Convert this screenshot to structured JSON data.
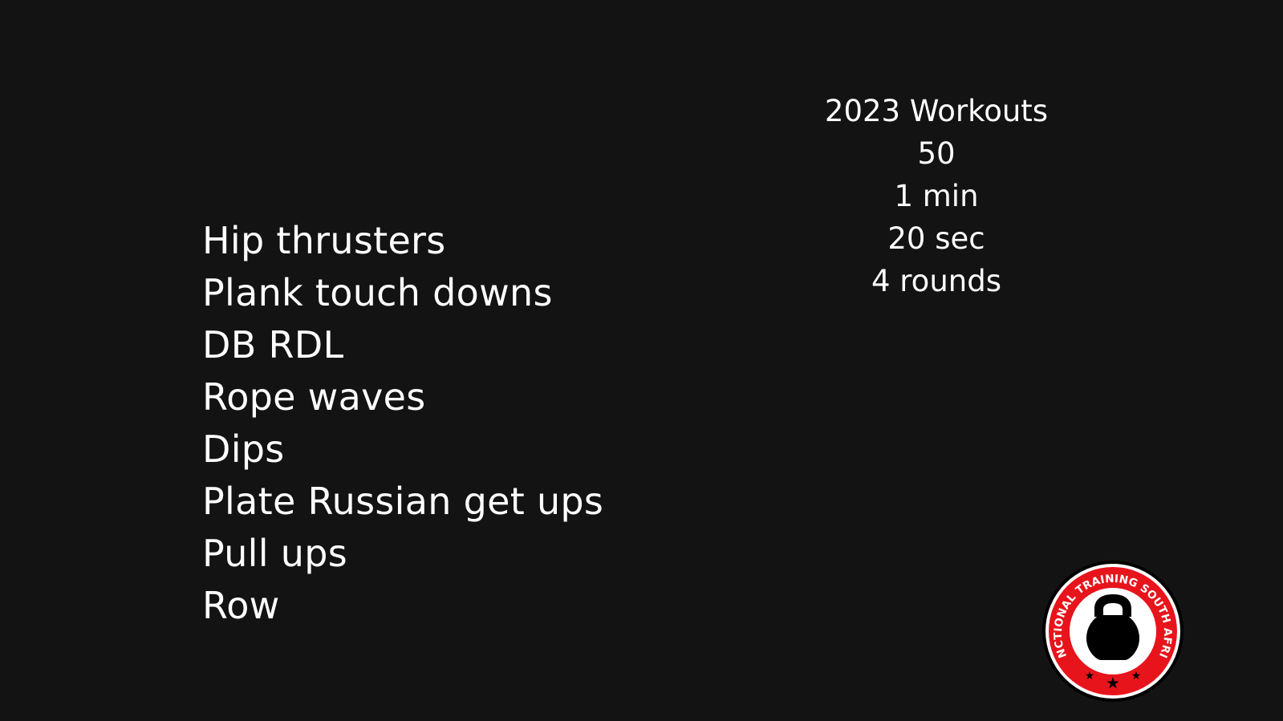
{
  "workout": {
    "exercises": [
      "Hip thrusters",
      "Plank touch downs",
      "DB RDL",
      "Rope waves",
      "Dips",
      "Plate Russian get ups",
      "Pull ups",
      "Row"
    ]
  },
  "info": {
    "title": "2023 Workouts",
    "number": "50",
    "work_time": "1 min",
    "rest_time": "20 sec",
    "rounds": "4 rounds"
  },
  "logo": {
    "text": "FUNCTIONAL TRAINING SOUTH AFRICA",
    "icon": "kettlebell-icon",
    "colors": {
      "ring": "#e8141c",
      "border": "#000000",
      "inner": "#ffffff",
      "kettlebell": "#000000"
    }
  },
  "colors": {
    "background": "#131313",
    "text": "#ffffff"
  }
}
